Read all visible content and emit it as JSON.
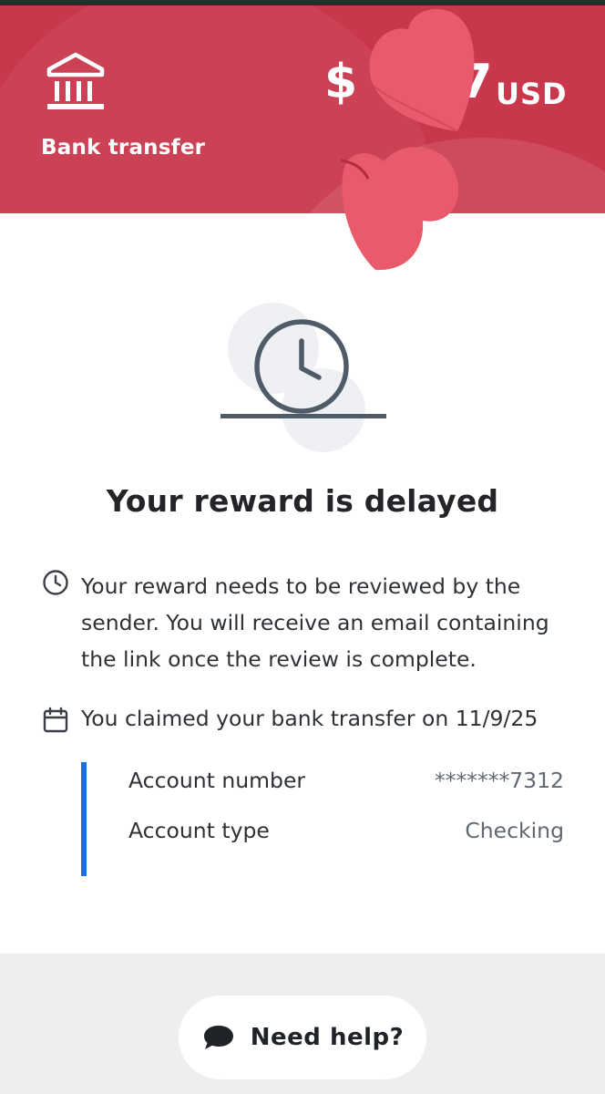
{
  "header": {
    "method_label": "Bank transfer",
    "amount_prefix": "$",
    "amount_suffix": "7",
    "currency": "USD",
    "bg_color": "#c9374c"
  },
  "status": {
    "title": "Your reward is delayed",
    "icon": "clock-icon"
  },
  "info": {
    "review_message": "Your reward needs to be reviewed by the sender. You will receive an email containing the link once the review is complete.",
    "review_icon": "clock-icon",
    "claim_message": "You claimed your bank transfer on 11/9/25",
    "claim_icon": "calendar-icon"
  },
  "account": {
    "accent_color": "#1e6fe0",
    "rows": [
      {
        "label": "Account number",
        "value": "*******7312"
      },
      {
        "label": "Account type",
        "value": "Checking"
      }
    ]
  },
  "footer": {
    "help_label": "Need help?",
    "help_icon": "chat-bubble-icon"
  },
  "overlay": {
    "sticker": "heart-sticker",
    "sticker_color": "#e85a6c"
  }
}
